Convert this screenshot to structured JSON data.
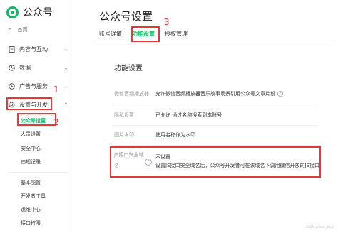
{
  "app": {
    "title": "公众号"
  },
  "sidebar": {
    "home_label": "首页",
    "groups": [
      {
        "label": "内容与互动",
        "icon": "document-icon"
      },
      {
        "label": "数据",
        "icon": "chart-icon"
      },
      {
        "label": "广告与服务",
        "icon": "ad-icon"
      },
      {
        "label": "设置与开发",
        "icon": "gear-icon"
      }
    ],
    "settings_items": [
      "公众号设置",
      "人员设置",
      "安全中心",
      "违规记录"
    ],
    "dev_items": [
      "基本配置",
      "开发者工具",
      "运维中心",
      "接口权限"
    ]
  },
  "header": {
    "page_title": "公众号设置"
  },
  "tabs": [
    "账号详情",
    "功能设置",
    "授权管理"
  ],
  "main": {
    "section_title": "功能设置",
    "rows": [
      {
        "label": "微信音频播放器",
        "value": "允许微信音频播放器音乐故事场景引用公众号文章片段"
      },
      {
        "label": "隐私设置",
        "value": "已允许 通过名称搜索到本账号"
      },
      {
        "label": "图片水印",
        "value": "使用名称作为水印"
      }
    ],
    "js_domain": {
      "label_line1": "JS接口安全域",
      "label_line2": "名",
      "status": "未设置",
      "description": "设置JS接口安全域名后，公众号开发者可在该域名下调用微信开放的JS接口"
    }
  },
  "annotations": {
    "num1": "1",
    "num2": "2",
    "num3": "3"
  },
  "watermark": "CSDN @dank_Zhao",
  "colors": {
    "accent": "#07c160",
    "highlight": "#e53935"
  }
}
